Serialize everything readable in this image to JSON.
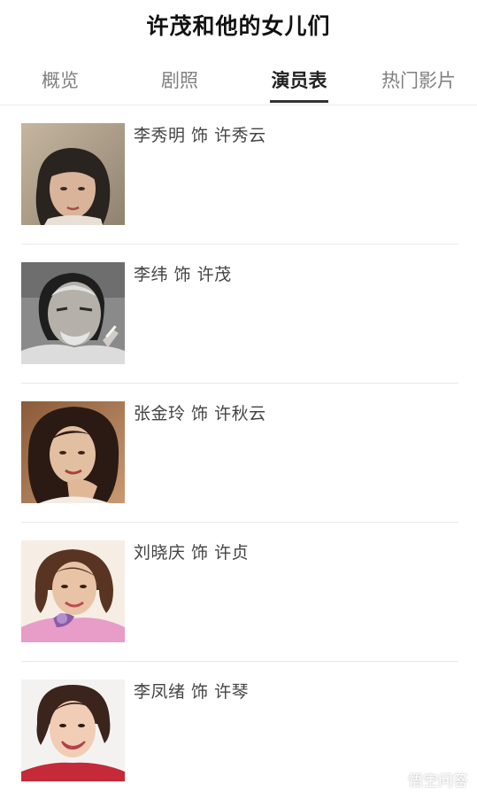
{
  "header": {
    "title": "许茂和他的女儿们"
  },
  "tabs": [
    {
      "label": "概览",
      "active": false
    },
    {
      "label": "剧照",
      "active": false
    },
    {
      "label": "演员表",
      "active": true
    },
    {
      "label": "热门影片",
      "active": false
    }
  ],
  "cast": [
    {
      "name_line": "李秀明 饰 许秀云",
      "photo_style": "sepia-portrait-woman"
    },
    {
      "name_line": "李纬 饰 许茂",
      "photo_style": "bw-portrait-man"
    },
    {
      "name_line": "张金玲 饰 许秋云",
      "photo_style": "warm-portrait-woman"
    },
    {
      "name_line": "刘晓庆 饰 许贞",
      "photo_style": "color-portrait-woman-pink"
    },
    {
      "name_line": "李凤绪 饰 许琴",
      "photo_style": "color-portrait-woman-smile"
    }
  ],
  "watermark": {
    "text": "悟空问答",
    "icon": "wukong-logo-icon"
  },
  "colors": {
    "active_tab": "#222222",
    "inactive_tab": "#808080",
    "divider": "#e8e8e8"
  }
}
